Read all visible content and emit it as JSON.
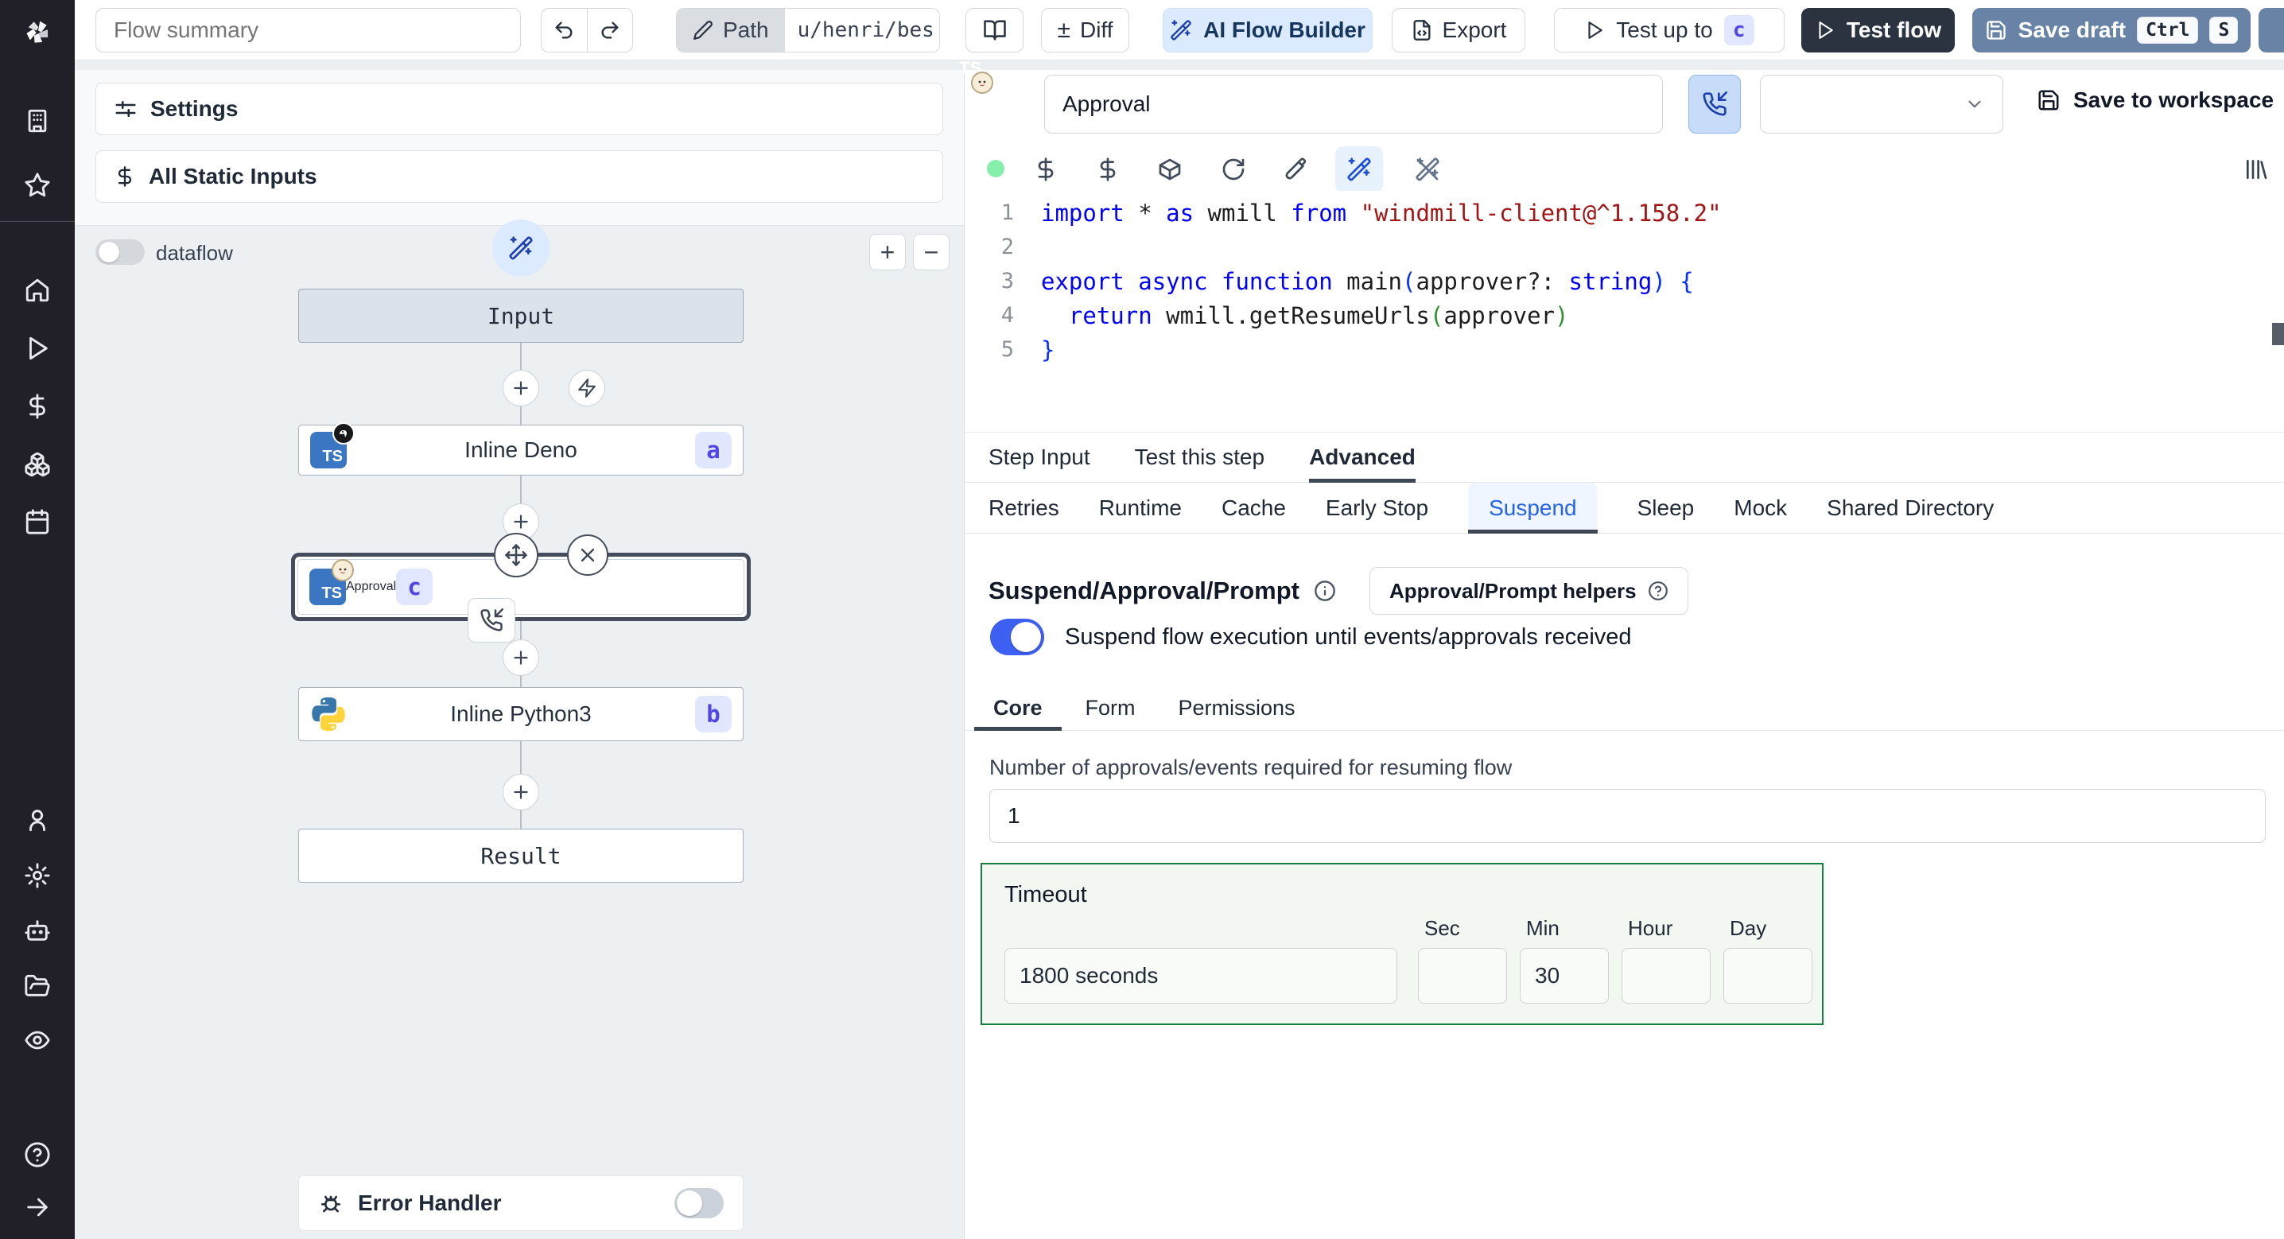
{
  "topbar": {
    "flow_summary_placeholder": "Flow summary",
    "path_label": "Path",
    "path_value": "u/henri/bes",
    "diff_label": "Diff",
    "ai_flow_builder_label": "AI Flow Builder",
    "export_label": "Export",
    "test_up_to_label": "Test up to",
    "test_up_to_badge": "c",
    "test_flow_label": "Test flow",
    "save_draft_label": "Save draft",
    "save_draft_kbd": [
      "Ctrl",
      "S"
    ]
  },
  "left_panel": {
    "settings_label": "Settings",
    "all_static_inputs_label": "All Static Inputs",
    "dataflow_label": "dataflow",
    "error_handler_label": "Error Handler",
    "graph_nodes": [
      {
        "label": "Input"
      },
      {
        "label": "Inline Deno",
        "badge": "a",
        "lang": "deno"
      },
      {
        "label": "Approval",
        "badge": "c",
        "lang": "bun"
      },
      {
        "label": "Inline Python3",
        "badge": "b",
        "lang": "python3"
      },
      {
        "label": "Result"
      }
    ]
  },
  "step_editor": {
    "name_value": "Approval",
    "save_to_workspace_label": "Save to workspace",
    "code": {
      "lines": [
        {
          "n": "1",
          "tokens": [
            {
              "c": "kw",
              "t": "import"
            },
            {
              "c": "pl",
              "t": " * "
            },
            {
              "c": "kw",
              "t": "as"
            },
            {
              "c": "pl",
              "t": " wmill "
            },
            {
              "c": "kw",
              "t": "from"
            },
            {
              "c": "pl",
              "t": " "
            },
            {
              "c": "str",
              "t": "\"windmill-client@^1.158.2\""
            }
          ]
        },
        {
          "n": "2",
          "tokens": []
        },
        {
          "n": "3",
          "tokens": [
            {
              "c": "kw",
              "t": "export"
            },
            {
              "c": "pl",
              "t": " "
            },
            {
              "c": "kw",
              "t": "async"
            },
            {
              "c": "pl",
              "t": " "
            },
            {
              "c": "kw",
              "t": "function"
            },
            {
              "c": "pl",
              "t": " main"
            },
            {
              "c": "b1",
              "t": "("
            },
            {
              "c": "pl",
              "t": "approver?: "
            },
            {
              "c": "kw",
              "t": "string"
            },
            {
              "c": "b1",
              "t": ")"
            },
            {
              "c": "pl",
              "t": " "
            },
            {
              "c": "b1",
              "t": "{"
            }
          ]
        },
        {
          "n": "4",
          "tokens": [
            {
              "c": "pl",
              "t": "  "
            },
            {
              "c": "kw",
              "t": "return"
            },
            {
              "c": "pl",
              "t": " wmill.getResumeUrls"
            },
            {
              "c": "b2",
              "t": "("
            },
            {
              "c": "pl",
              "t": "approver"
            },
            {
              "c": "b2",
              "t": ")"
            }
          ]
        },
        {
          "n": "5",
          "tokens": [
            {
              "c": "b1",
              "t": "}"
            }
          ]
        }
      ]
    },
    "tabs": [
      "Step Input",
      "Test this step",
      "Advanced"
    ],
    "active_tab": "Advanced",
    "subtabs": [
      "Retries",
      "Runtime",
      "Cache",
      "Early Stop",
      "Suspend",
      "Sleep",
      "Mock",
      "Shared Directory"
    ],
    "active_subtab": "Suspend",
    "suspend": {
      "heading": "Suspend/Approval/Prompt",
      "helpers_button_label": "Approval/Prompt helpers",
      "toggle_label": "Suspend flow execution until events/approvals received",
      "tabs": [
        "Core",
        "Form",
        "Permissions"
      ],
      "active_tab": "Core",
      "approvals_label": "Number of approvals/events required for resuming flow",
      "approvals_value": "1",
      "timeout": {
        "label": "Timeout",
        "display_value": "1800 seconds",
        "units": [
          "Sec",
          "Min",
          "Hour",
          "Day"
        ],
        "values": {
          "sec": "",
          "min": "30",
          "hour": "",
          "day": ""
        }
      }
    }
  },
  "colors": {
    "accent_blue": "#2563eb",
    "toggle_on": "#3d5ff2",
    "save_draft_bg": "#6883a5",
    "test_flow_bg": "#2b3340",
    "ai_builder_bg": "#dbeafe",
    "badge_bg": "#e0e7ff",
    "badge_text": "#4f46e5",
    "timeout_border": "#15803d",
    "status_dot": "#86efac"
  }
}
